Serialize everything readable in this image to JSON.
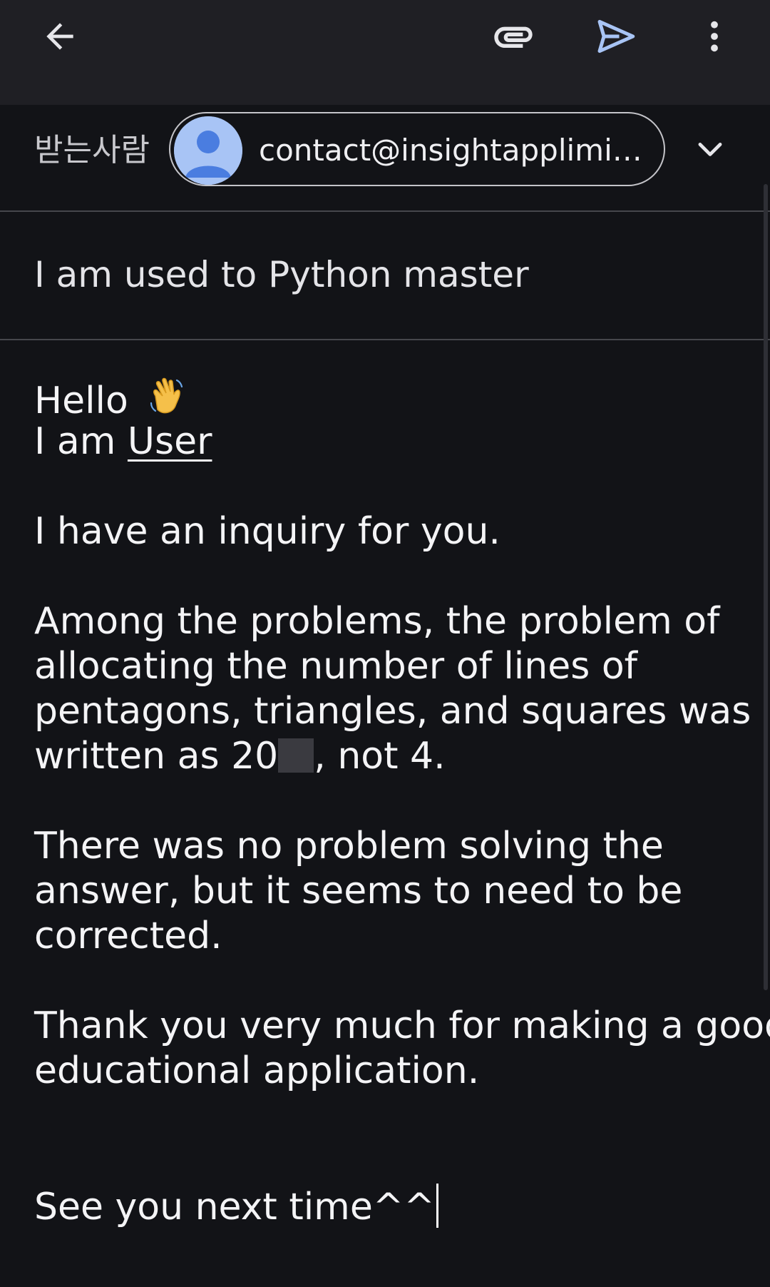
{
  "toolbar": {
    "back_icon": "arrow-back-icon",
    "attach_icon": "paperclip-icon",
    "send_icon": "send-icon",
    "more_icon": "more-vert-icon",
    "send_color": "#a8c4f5"
  },
  "recipients": {
    "label": "받는사람",
    "chip_text": "contact@insightapplimite…",
    "avatar_icon": "person-avatar-icon",
    "expand_icon": "chevron-down-icon"
  },
  "subject": {
    "value": "I am used to Python master"
  },
  "body": {
    "greeting": "Hello",
    "greeting_emoji": "waving-hand-icon",
    "intro_prefix": "I am ",
    "intro_name": "User",
    "inquiry": "I have an inquiry for you.",
    "p2_line1": "Among the problems, the problem of",
    "p2_line2": "allocating the number of lines of",
    "p2_line3": "pentagons, triangles, and squares was",
    "p2_line4_prefix": "written as 20",
    "p2_line4_suffix": ", not 4.",
    "p3_line1": "There was no problem solving the",
    "p3_line2": "answer, but it seems to need to be",
    "p3_line3": "corrected.",
    "p4_line1": "Thank you very much for making a good",
    "p4_line2": "educational application.",
    "closing": "See you next time^^"
  },
  "colors": {
    "background": "#121317",
    "toolbar": "#1f1f24",
    "accent": "#a8c4f5",
    "avatar": "#4a7de0"
  }
}
